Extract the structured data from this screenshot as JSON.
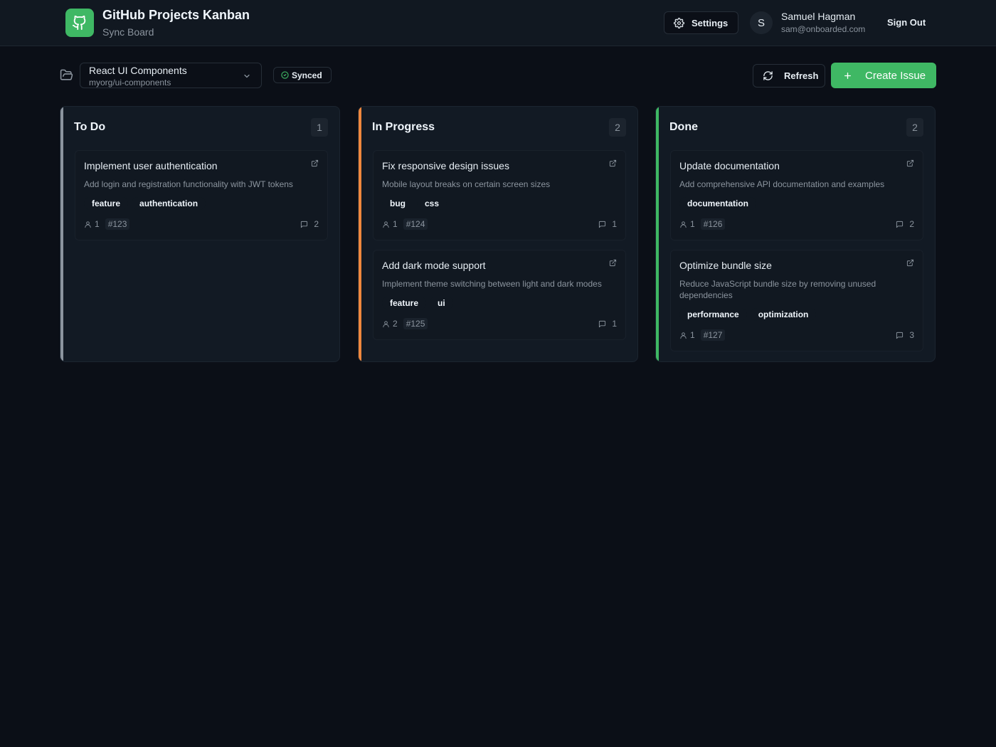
{
  "header": {
    "title": "GitHub Projects Kanban",
    "subtitle": "Sync Board",
    "settings_label": "Settings",
    "user": {
      "initial": "S",
      "name": "Samuel Hagman",
      "email": "sam@onboarded.com"
    },
    "signout_label": "Sign Out"
  },
  "toolbar": {
    "project_name": "React UI Components",
    "project_repo": "myorg/ui-components",
    "sync_status": "Synced",
    "refresh_label": "Refresh",
    "create_label": "Create Issue"
  },
  "colors": {
    "accent": "#3fb864",
    "todo": "#8b949e",
    "in_progress": "#f0883e",
    "done": "#3fb864"
  },
  "columns": [
    {
      "title": "To Do",
      "count": "1",
      "cards": [
        {
          "title": "Implement user authentication",
          "description": "Add login and registration functionality with JWT tokens",
          "labels": [
            "feature",
            "authentication"
          ],
          "assignees": "1",
          "number": "#123",
          "comments": "2"
        }
      ]
    },
    {
      "title": "In Progress",
      "count": "2",
      "cards": [
        {
          "title": "Fix responsive design issues",
          "description": "Mobile layout breaks on certain screen sizes",
          "labels": [
            "bug",
            "css"
          ],
          "assignees": "1",
          "number": "#124",
          "comments": "1"
        },
        {
          "title": "Add dark mode support",
          "description": "Implement theme switching between light and dark modes",
          "labels": [
            "feature",
            "ui"
          ],
          "assignees": "2",
          "number": "#125",
          "comments": "1"
        }
      ]
    },
    {
      "title": "Done",
      "count": "2",
      "cards": [
        {
          "title": "Update documentation",
          "description": "Add comprehensive API documentation and examples",
          "labels": [
            "documentation"
          ],
          "assignees": "1",
          "number": "#126",
          "comments": "2"
        },
        {
          "title": "Optimize bundle size",
          "description": "Reduce JavaScript bundle size by removing unused dependencies",
          "labels": [
            "performance",
            "optimization"
          ],
          "assignees": "1",
          "number": "#127",
          "comments": "3"
        }
      ]
    }
  ]
}
